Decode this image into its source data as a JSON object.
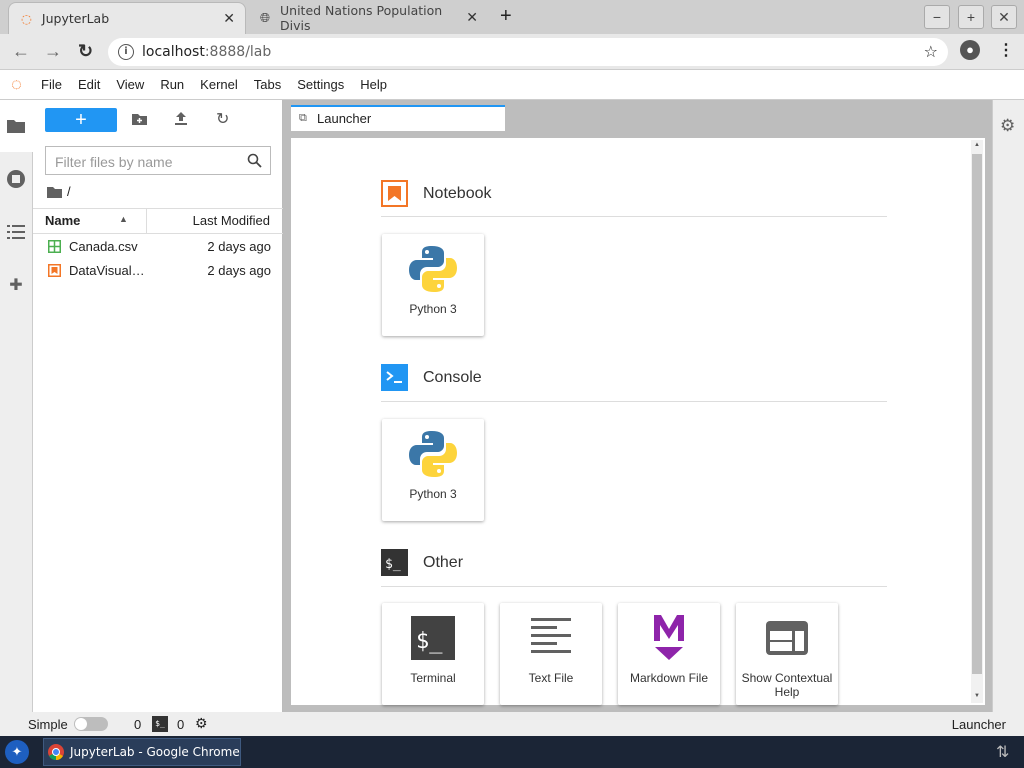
{
  "browser": {
    "tabs": [
      {
        "title": "JupyterLab",
        "active": true
      },
      {
        "title": "United Nations Population Divis",
        "active": false
      }
    ],
    "url_host": "localhost",
    "url_rest": ":8888/lab"
  },
  "menubar": {
    "items": [
      "File",
      "Edit",
      "View",
      "Run",
      "Kernel",
      "Tabs",
      "Settings",
      "Help"
    ]
  },
  "filebrowser": {
    "new_label": "+",
    "filter_placeholder": "Filter files by name",
    "breadcrumb": "/",
    "columns": {
      "name": "Name",
      "modified": "Last Modified"
    },
    "files": [
      {
        "name": "Canada.csv",
        "modified": "2 days ago",
        "type": "csv"
      },
      {
        "name": "DataVisual…",
        "modified": "2 days ago",
        "type": "notebook"
      }
    ]
  },
  "main": {
    "tab_label": "Launcher"
  },
  "launcher": {
    "sections": [
      {
        "title": "Notebook",
        "cards": [
          "Python 3"
        ]
      },
      {
        "title": "Console",
        "cards": [
          "Python 3"
        ]
      },
      {
        "title": "Other",
        "cards": [
          "Terminal",
          "Text File",
          "Markdown File",
          "Show Contextual Help"
        ]
      }
    ]
  },
  "status": {
    "mode_label": "Simple",
    "terminals": "0",
    "kernels": "0",
    "right_label": "Launcher"
  },
  "taskbar": {
    "window_title": "JupyterLab - Google Chrome"
  },
  "colors": {
    "accent": "#2196f3",
    "jupyter_orange": "#f37626",
    "markdown_purple": "#8e24aa"
  }
}
